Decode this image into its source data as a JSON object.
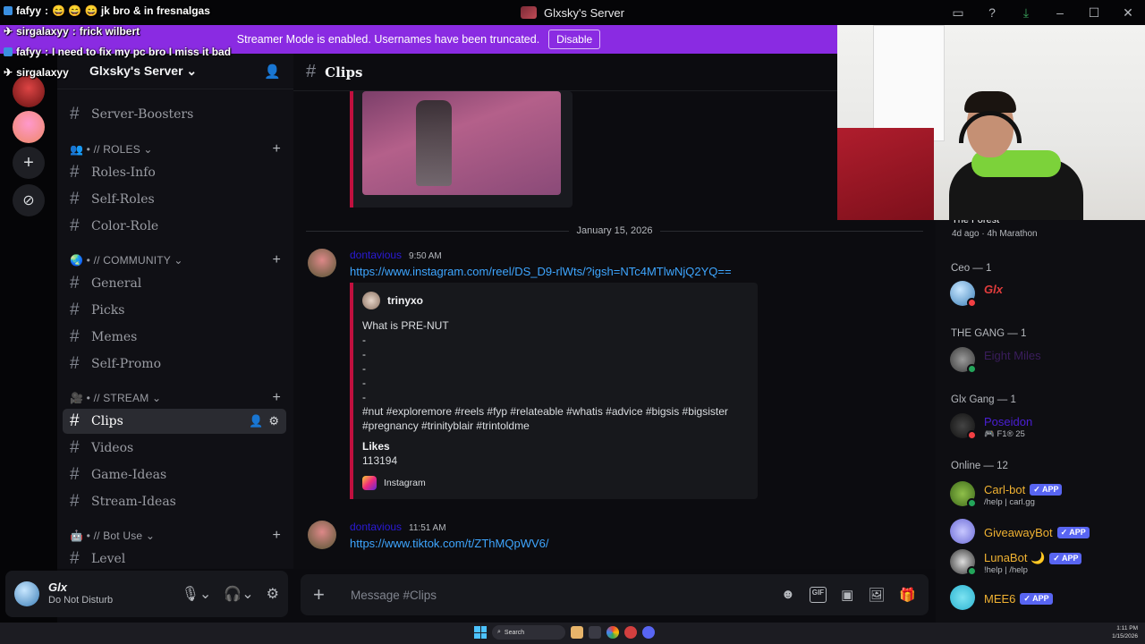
{
  "window": {
    "title": "Glxsky's Server"
  },
  "overlay_chat": [
    {
      "user": "fafyy",
      "text": "😄 😄 😄 jk bro & in fresnalgas"
    },
    {
      "user": "sirgalaxyy",
      "text": "frick wilbert"
    },
    {
      "user": "fafyy",
      "text": "I need to fix my pc bro I miss it bad"
    },
    {
      "user": "sirgalaxyy",
      "text": ""
    }
  ],
  "banner": {
    "text": "Streamer Mode is enabled. Usernames have been truncated.",
    "button": "Disable"
  },
  "server": {
    "name": "Glxsky's Server"
  },
  "sidebar": {
    "channels_top": [
      {
        "name": "Server-Boosters"
      }
    ],
    "categories": [
      {
        "label": "👥 • // ROLES ⌄",
        "channels": [
          "Roles-Info",
          "Self-Roles",
          "Color-Role"
        ]
      },
      {
        "label": "🌏 • // COMMUNITY ⌄",
        "channels": [
          "General",
          "Picks",
          "Memes",
          "Self-Promo"
        ]
      },
      {
        "label": "🎥 • // STREAM ⌄",
        "channels": [
          "Clips",
          "Videos",
          "Game-Ideas",
          "Stream-Ideas"
        ]
      },
      {
        "label": "🤖 • // Bot Use ⌄",
        "channels": [
          "Level"
        ]
      }
    ]
  },
  "user_panel": {
    "name": "Glx",
    "status": "Do Not Disturb"
  },
  "channel": {
    "name": "Clips"
  },
  "messages": {
    "date_divider": "January 15, 2026",
    "items": [
      {
        "author": "dontavious",
        "time": "9:50 AM",
        "link": "https://www.instagram.com/reel/DS_D9-rlWts/?igsh=NTc4MTlwNjQ2YQ==",
        "embed": {
          "author": "trinyxo",
          "description": "What is PRE-NUT\n-\n-\n-\n-\n-\n#nut #exploremore #reels #fyp #relateable #whatis #advice #bigsis #bigsister\n#pregnancy #trinityblair #trintoldme",
          "field_name": "Likes",
          "field_value": "113194",
          "footer": "Instagram"
        }
      },
      {
        "author": "dontavious",
        "time": "11:51 AM",
        "link": "https://www.tiktok.com/t/ZThMQpWV6/"
      }
    ]
  },
  "composer": {
    "placeholder": "Message #Clips"
  },
  "members": {
    "activity": {
      "title": "The Forest",
      "sub": "4d ago  ·  4h Marathon"
    },
    "groups": [
      {
        "label": "Ceo — 1"
      },
      {
        "label": "THE GANG — 1"
      },
      {
        "label": "Glx Gang — 1"
      },
      {
        "label": "Online — 12"
      }
    ],
    "list": [
      {
        "name": "Glx",
        "sub": "",
        "color": "#e03c3c",
        "status": "#f23f43",
        "app": ""
      },
      {
        "name": "Eight Miles",
        "sub": "",
        "color": "#3a1d5c",
        "status": "#23a55a",
        "app": ""
      },
      {
        "name": "Poseidon",
        "sub": "F1® 25",
        "color": "#4b1fd6",
        "status": "#f23f43",
        "app": ""
      },
      {
        "name": "Carl-bot",
        "sub": "/help | carl.gg",
        "color": "#f0b232",
        "status": "#23a55a",
        "app": "✓ APP"
      },
      {
        "name": "GiveawayBot",
        "sub": "",
        "color": "#f0b232",
        "status": "#23a55a",
        "app": "✓ APP"
      },
      {
        "name": "LunaBot 🌙",
        "sub": "!help | /help",
        "color": "#f0b232",
        "status": "#23a55a",
        "app": "✓ APP"
      },
      {
        "name": "MEE6",
        "sub": "",
        "color": "#f0b232",
        "status": "#23a55a",
        "app": "✓ APP"
      }
    ]
  },
  "taskbar": {
    "search": "Search",
    "time": "1:11 PM",
    "date": "1/15/2026"
  }
}
